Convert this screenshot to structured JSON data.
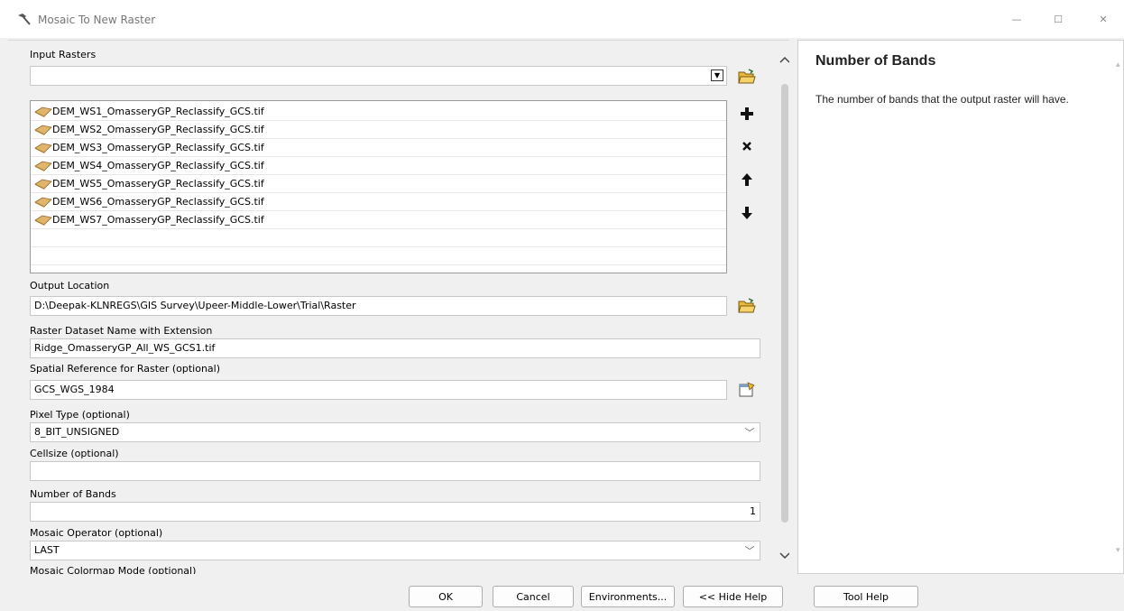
{
  "window": {
    "title": "Mosaic To New Raster",
    "minimize_glyph": "—",
    "maximize_glyph": "☐",
    "close_glyph": "✕"
  },
  "form": {
    "input_rasters": {
      "label": "Input Rasters",
      "value": "",
      "items": [
        "DEM_WS1_OmasseryGP_Reclassify_GCS.tif",
        "DEM_WS2_OmasseryGP_Reclassify_GCS.tif",
        "DEM_WS3_OmasseryGP_Reclassify_GCS.tif",
        "DEM_WS4_OmasseryGP_Reclassify_GCS.tif",
        "DEM_WS5_OmasseryGP_Reclassify_GCS.tif",
        "DEM_WS6_OmasseryGP_Reclassify_GCS.tif",
        "DEM_WS7_OmasseryGP_Reclassify_GCS.tif"
      ]
    },
    "output_location": {
      "label": "Output Location",
      "value": "D:\\Deepak-KLNREGS\\GIS Survey\\Upeer-Middle-Lower\\Trial\\Raster"
    },
    "raster_name": {
      "label": "Raster Dataset Name with Extension",
      "value": "Ridge_OmasseryGP_All_WS_GCS1.tif"
    },
    "spatial_reference": {
      "label": "Spatial Reference for Raster (optional)",
      "value": "GCS_WGS_1984"
    },
    "pixel_type": {
      "label": "Pixel Type (optional)",
      "value": "8_BIT_UNSIGNED"
    },
    "cellsize": {
      "label": "Cellsize (optional)",
      "value": ""
    },
    "number_of_bands": {
      "label": "Number of Bands",
      "value": "1"
    },
    "mosaic_operator": {
      "label": "Mosaic Operator (optional)",
      "value": "LAST"
    },
    "colormap_mode": {
      "label": "Mosaic Colormap Mode (optional)"
    }
  },
  "help": {
    "title": "Number of Bands",
    "text": "The number of bands that the output raster will have."
  },
  "buttons": {
    "ok": "OK",
    "cancel": "Cancel",
    "environments": "Environments...",
    "hide_help": "<< Hide Help",
    "tool_help": "Tool Help"
  },
  "icons": {
    "window_icon": "hammer-icon",
    "browse": "open-folder-icon",
    "add": "plus-icon",
    "remove": "x-icon",
    "move_up": "arrow-up-icon",
    "move_down": "arrow-down-icon",
    "raster_item": "raster-dataset-icon",
    "spatial_ref": "spatial-reference-properties-icon"
  },
  "colors": {
    "folder_yellow": "#e8b83a",
    "raster_tan": "#e2b56a",
    "help_bg": "#ffffff",
    "dialog_bg": "#f0f0f0"
  }
}
